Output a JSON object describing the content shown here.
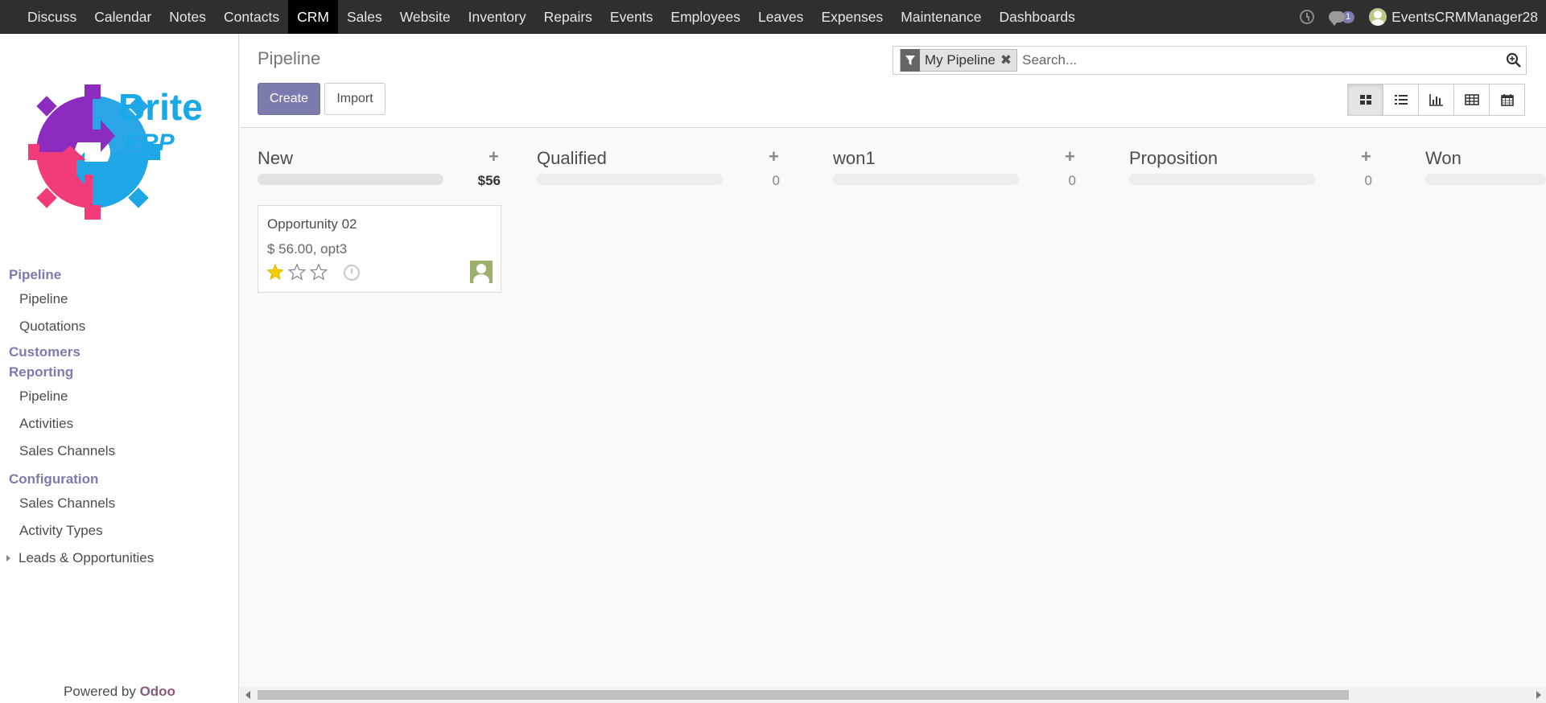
{
  "topbar": {
    "menus": [
      "Discuss",
      "Calendar",
      "Notes",
      "Contacts",
      "CRM",
      "Sales",
      "Website",
      "Inventory",
      "Repairs",
      "Events",
      "Employees",
      "Leaves",
      "Expenses",
      "Maintenance",
      "Dashboards"
    ],
    "active_menu": "CRM",
    "chat_badge": "1",
    "user_name": "EventsCRMManager28"
  },
  "sidebar": {
    "logo_text": "Brite ERP",
    "sections": [
      {
        "heading": "Pipeline",
        "items": [
          "Pipeline",
          "Quotations"
        ]
      },
      {
        "heading": "Customers",
        "items": []
      },
      {
        "heading": "Reporting",
        "items": [
          "Pipeline",
          "Activities",
          "Sales Channels"
        ]
      },
      {
        "heading": "Configuration",
        "items": [
          "Sales Channels",
          "Activity Types",
          "Leads & Opportunities"
        ]
      }
    ],
    "powered_by": "Powered by",
    "powered_brand": "Odoo"
  },
  "control_panel": {
    "breadcrumb": "Pipeline",
    "create_label": "Create",
    "import_label": "Import",
    "search_facet": "My Pipeline",
    "search_placeholder": "Search...",
    "views": [
      "kanban-icon",
      "list-icon",
      "graph-icon",
      "pivot-icon",
      "calendar-icon"
    ],
    "active_view": "kanban"
  },
  "kanban": {
    "columns": [
      {
        "title": "New",
        "total": "$56"
      },
      {
        "title": "Qualified",
        "total": "0"
      },
      {
        "title": "won1",
        "total": "0"
      },
      {
        "title": "Proposition",
        "total": "0"
      },
      {
        "title": "Won",
        "total": ""
      }
    ],
    "cards": [
      {
        "name": "Opportunity 02",
        "amount": "$ 56.00, opt3",
        "priority": 1,
        "priority_max": 3
      }
    ]
  },
  "colors": {
    "brand": "#7c7bad",
    "navbar": "#2f2f2f",
    "star": "#f3cc00"
  }
}
